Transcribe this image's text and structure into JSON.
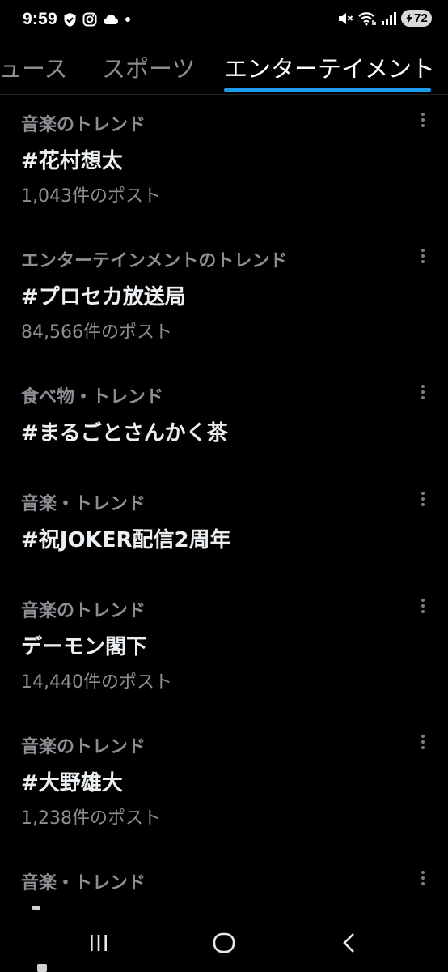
{
  "status_bar": {
    "time": "9:59",
    "battery": "72",
    "left_icons": [
      "shield-check-icon",
      "instagram-icon",
      "cloud-icon",
      "dot-icon"
    ],
    "right_icons": [
      "mute-icon",
      "wifi-icon",
      "signal-icon"
    ]
  },
  "tabs": [
    {
      "label": "ュース",
      "active": false
    },
    {
      "label": "スポーツ",
      "active": false
    },
    {
      "label": "エンターテイメント",
      "active": true
    }
  ],
  "accent_color": "#1d9bf0",
  "trends": [
    {
      "context": "音楽のトレンド",
      "title": "#花村想太",
      "count": "1,043件のポスト"
    },
    {
      "context": "エンターテインメントのトレンド",
      "title": "#プロセカ放送局",
      "count": "84,566件のポスト"
    },
    {
      "context": "食べ物・トレンド",
      "title": "#まるごとさんかく茶",
      "count": ""
    },
    {
      "context": "音楽・トレンド",
      "title": "#祝JOKER配信2周年",
      "count": ""
    },
    {
      "context": "音楽のトレンド",
      "title": "デーモン閣下",
      "count": "14,440件のポスト"
    },
    {
      "context": "音楽のトレンド",
      "title": "#大野雄大",
      "count": "1,238件のポスト"
    },
    {
      "context": "音楽・トレンド",
      "title": "",
      "count": ""
    }
  ],
  "nav_bar": {
    "recents_icon": "recents-icon",
    "home_icon": "home-icon",
    "back_icon": "back-icon"
  }
}
